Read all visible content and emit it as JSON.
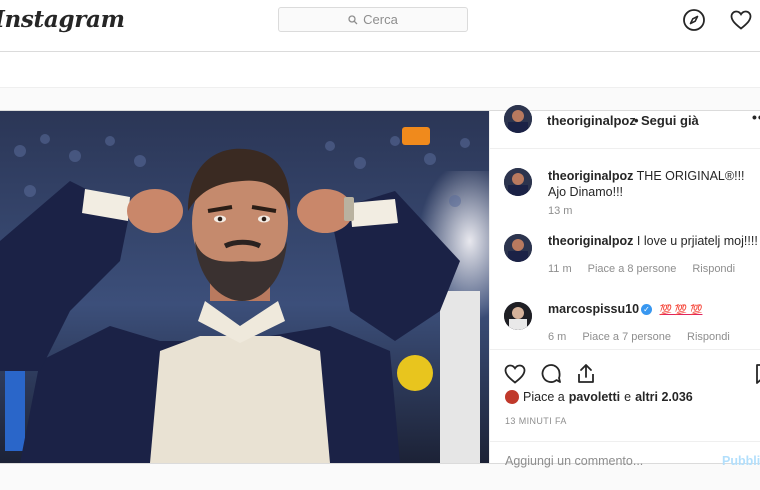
{
  "nav": {
    "logo": "Instagram",
    "search_placeholder": "Cerca",
    "icons": [
      "compass-icon",
      "heart-icon"
    ]
  },
  "post": {
    "author": "theoriginalpoz",
    "separator": "•",
    "follow_status": "Segui già",
    "more_icon": "more-horizontal-icon",
    "comments": [
      {
        "user": "theoriginalpoz",
        "text": "THE ORIGINAL®!!! Ajo Dinamo!!!",
        "time": "13 m",
        "likes": "",
        "reply": ""
      },
      {
        "user": "theoriginalpoz",
        "text": "I love u prjiatelj moj!!!!",
        "time": "11 m",
        "likes": "Piace a 8 persone",
        "reply": "Rispondi"
      },
      {
        "user": "marcospissu10",
        "verified": true,
        "text": "💯 💯 💯",
        "time": "6 m",
        "likes": "Piace a 7 persone",
        "reply": "Rispondi"
      }
    ],
    "likes_user": "pavoletti",
    "likes_text_prefix": "Piace a",
    "likes_text_mid": "e",
    "likes_others": "altri 2.036",
    "timestamp": "13 MINUTI FA",
    "add_comment_placeholder": "Aggiungi un commento...",
    "publish_label": "Pubblica"
  },
  "colors": {
    "accent": "#3897f0",
    "publish_disabled": "#b2dffc",
    "meta_text": "#8e8e8e",
    "border": "#dbdbdb"
  }
}
